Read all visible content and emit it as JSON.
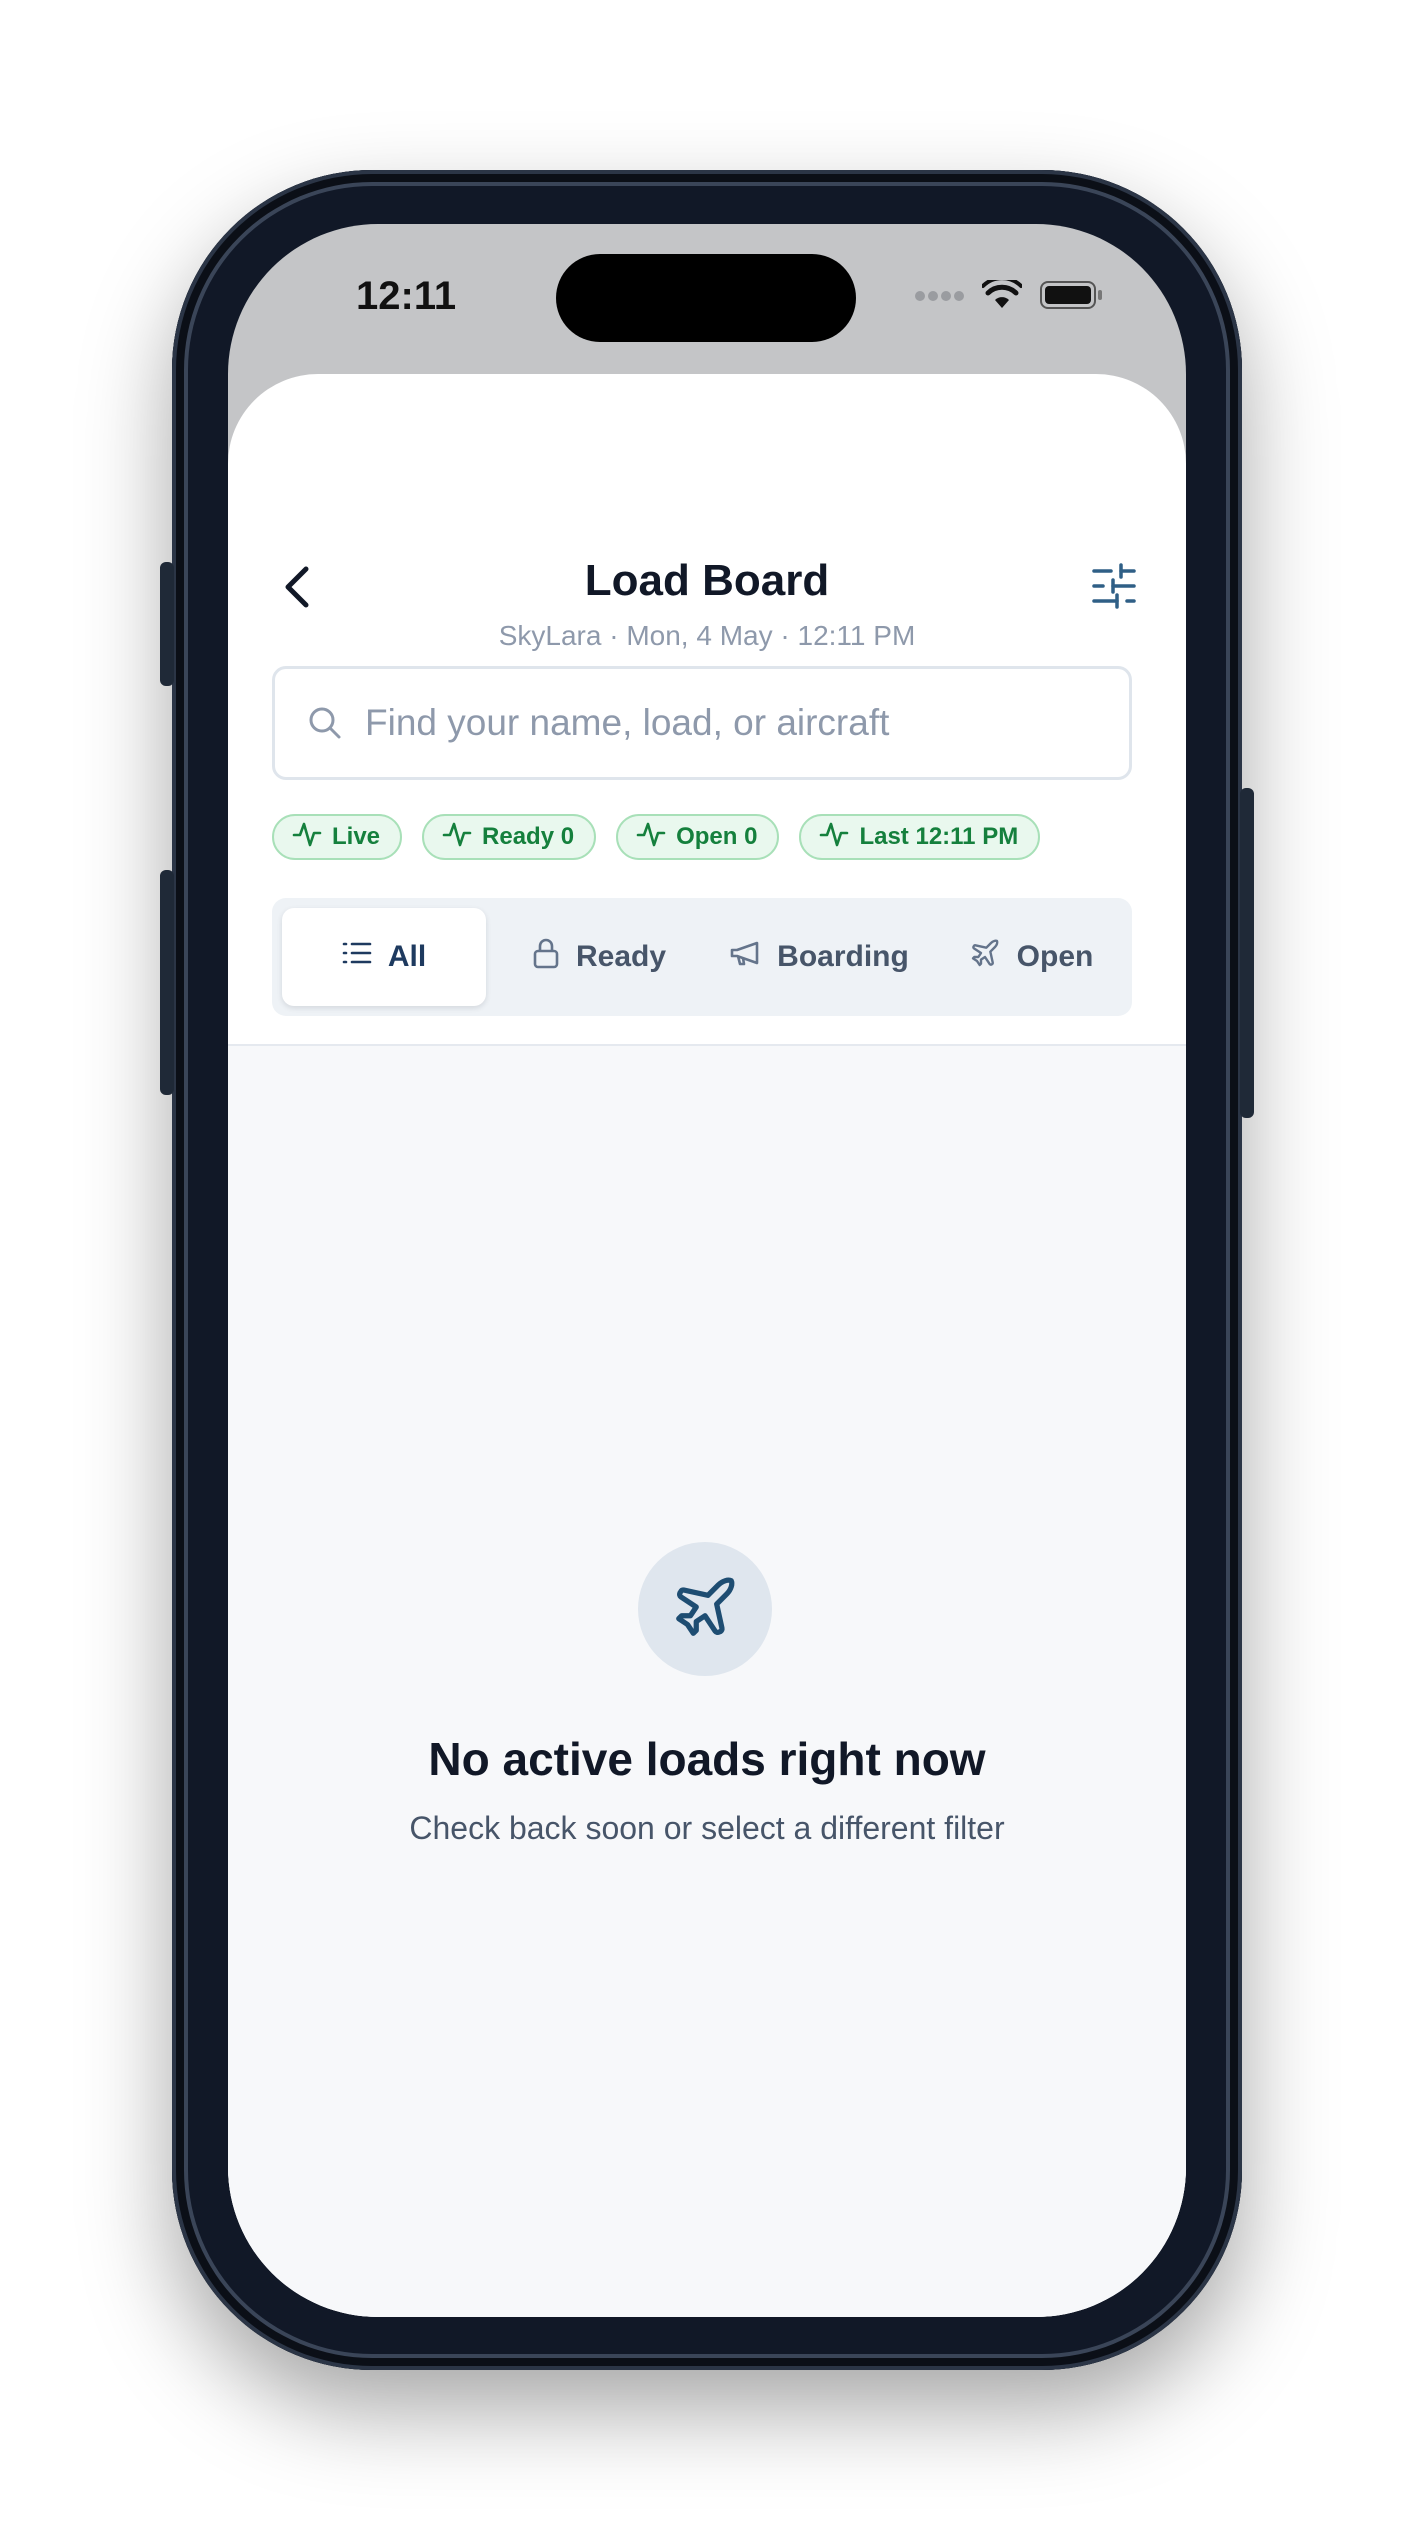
{
  "status_bar": {
    "time": "12:11"
  },
  "header": {
    "title": "Load Board",
    "subtitle": "SkyLara · Mon, 4 May · 12:11 PM"
  },
  "search": {
    "placeholder": "Find your name, load, or aircraft",
    "value": ""
  },
  "chips": [
    {
      "label": "Live",
      "icon": "activity-icon"
    },
    {
      "label": "Ready 0",
      "icon": "activity-icon"
    },
    {
      "label": "Open 0",
      "icon": "activity-icon"
    },
    {
      "label": "Last 12:11 PM",
      "icon": "activity-icon"
    }
  ],
  "tabs": [
    {
      "label": "All",
      "icon": "list-icon",
      "selected": true
    },
    {
      "label": "Ready",
      "icon": "lock-icon",
      "selected": false
    },
    {
      "label": "Boarding",
      "icon": "megaphone-icon",
      "selected": false
    },
    {
      "label": "Open",
      "icon": "plane-icon",
      "selected": false
    }
  ],
  "empty_state": {
    "icon": "plane-icon",
    "title": "No active loads right now",
    "subtitle": "Check back soon or select a different filter"
  },
  "colors": {
    "accent": "#1e3a5f",
    "chip_green": "#15803d",
    "chip_bg": "#e9f8ee",
    "muted_text": "#8e99ab"
  }
}
